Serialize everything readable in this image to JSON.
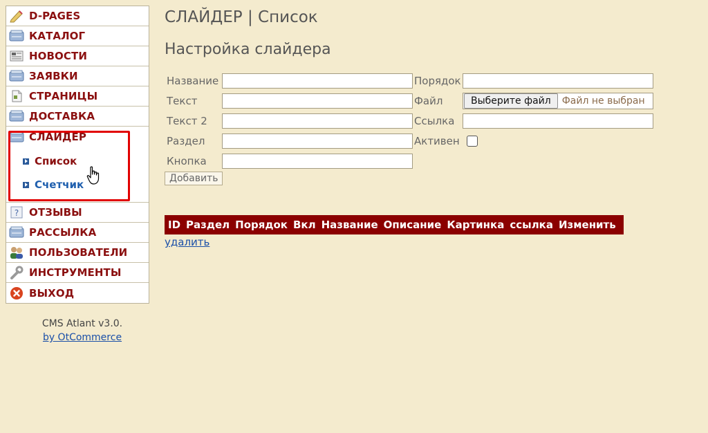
{
  "sidebar": {
    "items_top": [
      {
        "label": "D-PAGES",
        "icon": "pencil-icon"
      },
      {
        "label": "КАТАЛОГ",
        "icon": "catalog-icon"
      },
      {
        "label": "НОВОСТИ",
        "icon": "news-icon"
      },
      {
        "label": "ЗАЯВКИ",
        "icon": "orders-icon"
      },
      {
        "label": "СТРАНИЦЫ",
        "icon": "pages-icon"
      },
      {
        "label": "ДОСТАВКА",
        "icon": "delivery-icon"
      }
    ],
    "slider_group": {
      "label": "СЛАЙДЕР",
      "icon": "slider-icon",
      "sub_items": [
        {
          "label": "Список",
          "active": true
        },
        {
          "label": "Счетчик",
          "active": false
        }
      ]
    },
    "items_bottom": [
      {
        "label": "ОТЗЫВЫ",
        "icon": "reviews-icon"
      },
      {
        "label": "РАССЫЛКА",
        "icon": "mailing-icon"
      },
      {
        "label": "ПОЛЬЗОВАТЕЛИ",
        "icon": "users-icon"
      },
      {
        "label": "ИНСТРУМЕНТЫ",
        "icon": "tools-icon"
      },
      {
        "label": "ВЫХОД",
        "icon": "exit-icon"
      }
    ]
  },
  "footer": {
    "version": "CMS Atlant v3.0.",
    "link": "by OtCommerce"
  },
  "page": {
    "title": "СЛАЙДЕР | Список",
    "section_title": "Настройка слайдера"
  },
  "form": {
    "name_label": "Название",
    "text_label": "Текст",
    "text2_label": "Текст 2",
    "section_label": "Раздел",
    "button_label": "Кнопка",
    "order_label": "Порядок",
    "file_label": "Файл",
    "link_label": "Ссылка",
    "active_label": "Активен",
    "file_button": "Выберите файл",
    "file_status": "Файл не выбран",
    "add_button": "Добавить"
  },
  "table": {
    "columns": [
      "ID",
      "Раздел",
      "Порядок",
      "Вкл",
      "Название",
      "Описание",
      "Картинка",
      "ссылка",
      "Изменить"
    ],
    "delete_link": "удалить"
  },
  "colors": {
    "background": "#f4ebce",
    "menu_label": "#8b1010",
    "highlight": "#e10000",
    "table_header": "#8b0000",
    "link": "#1a4fa8"
  }
}
